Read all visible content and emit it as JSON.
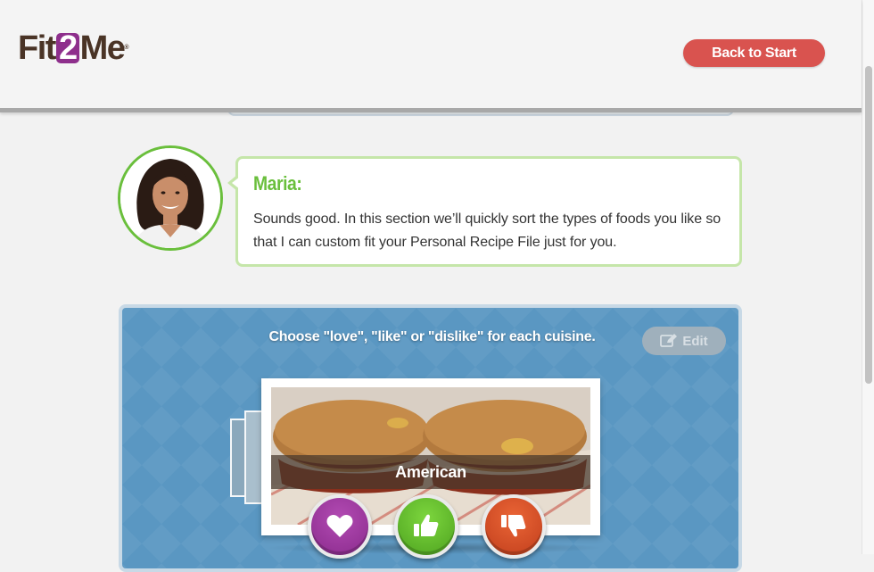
{
  "header": {
    "logo": {
      "part1": "Fit",
      "part2": "2",
      "part3": "Me",
      "tm": "®"
    },
    "back_button_label": "Back to Start"
  },
  "coach": {
    "name": "Maria:",
    "message": "Sounds good. In this section we’ll quickly sort the types of foods you like so that I can custom fit your Personal Recipe File just for you."
  },
  "panel": {
    "instructions": "Choose \"love\", \"like\" or \"dislike\" for each cuisine.",
    "edit_label": "Edit",
    "current_card": {
      "label": "American"
    },
    "buttons": [
      {
        "id": "love",
        "icon": "heart-icon",
        "color": "#9b3a9d"
      },
      {
        "id": "like",
        "icon": "thumbs-up-icon",
        "color": "#5cb82b"
      },
      {
        "id": "dislike",
        "icon": "thumbs-down-icon",
        "color": "#d64b26"
      }
    ]
  },
  "colors": {
    "accent_red": "#d9534f",
    "accent_green": "#6abf3c",
    "brand_purple": "#8e2f8c",
    "panel_blue": "#5a97c2"
  }
}
